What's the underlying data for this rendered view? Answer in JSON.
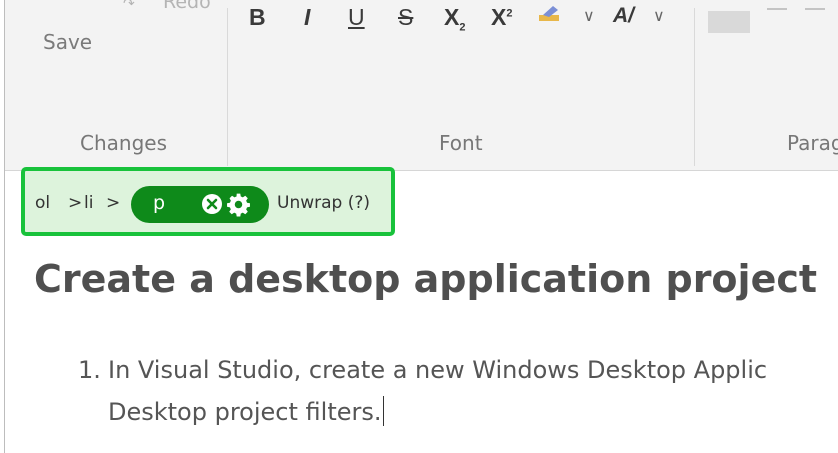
{
  "ribbon": {
    "undo_redo": {
      "redo_label": "Redo"
    },
    "save_label": "Save",
    "groups": {
      "changes": "Changes",
      "font": "Font",
      "paragraph": "Parag"
    },
    "font_buttons": {
      "bold": "B",
      "italic": "I",
      "underline": "U",
      "strikethrough": "S",
      "subscript_base": "X",
      "subscript_mark": "2",
      "superscript_base": "X",
      "superscript_mark": "2"
    },
    "icons": [
      "redo-icon",
      "highlight-icon",
      "font-color-icon",
      "chevron-down-icon"
    ]
  },
  "breadcrumb": {
    "items": [
      "ol",
      "li"
    ],
    "separator": ">",
    "active_tag": "p",
    "unwrap_label": "Unwrap (?)",
    "accent_color": "#18c23b",
    "pill_color": "#0e8a1a",
    "bar_background": "#ddf3dc"
  },
  "document": {
    "title": "Create a desktop application project",
    "list": [
      {
        "number": "1.",
        "lines": [
          "In Visual Studio, create a new Windows Desktop Applic",
          "Desktop project filters."
        ]
      }
    ]
  }
}
